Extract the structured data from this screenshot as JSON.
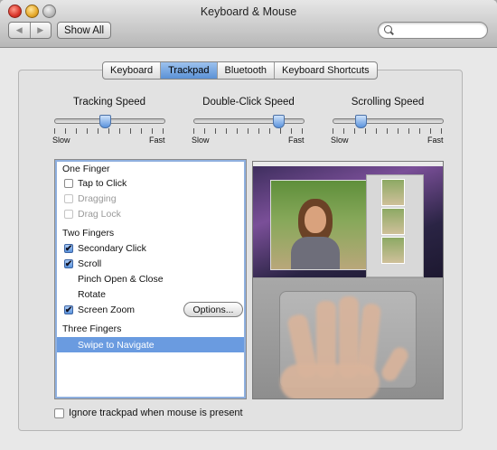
{
  "window": {
    "title": "Keyboard & Mouse",
    "show_all": "Show All",
    "search_placeholder": "",
    "nav_back": "◀",
    "nav_forward": "▶"
  },
  "tabs": [
    {
      "label": "Keyboard",
      "active": false
    },
    {
      "label": "Trackpad",
      "active": true
    },
    {
      "label": "Bluetooth",
      "active": false
    },
    {
      "label": "Keyboard Shortcuts",
      "active": false
    }
  ],
  "sliders": [
    {
      "label": "Tracking Speed",
      "min_label": "Slow",
      "max_label": "Fast",
      "value": 0.45
    },
    {
      "label": "Double-Click Speed",
      "min_label": "Slow",
      "max_label": "Fast",
      "value": 0.75
    },
    {
      "label": "Scrolling Speed",
      "min_label": "Slow",
      "max_label": "Fast",
      "value": 0.25
    }
  ],
  "gestures": {
    "one_finger": {
      "header": "One Finger",
      "items": [
        {
          "label": "Tap to Click",
          "checked": false,
          "disabled": false
        },
        {
          "label": "Dragging",
          "checked": false,
          "disabled": true
        },
        {
          "label": "Drag Lock",
          "checked": false,
          "disabled": true
        }
      ]
    },
    "two_fingers": {
      "header": "Two Fingers",
      "items": [
        {
          "label": "Secondary Click",
          "checked": true
        },
        {
          "label": "Scroll",
          "checked": true
        },
        {
          "label": "Pinch Open & Close"
        },
        {
          "label": "Rotate"
        },
        {
          "label": "Screen Zoom",
          "checked": true
        }
      ]
    },
    "three_fingers": {
      "header": "Three Fingers",
      "items": [
        {
          "label": "Swipe to Navigate",
          "selected": true
        }
      ]
    },
    "options_button": "Options..."
  },
  "footer": {
    "ignore_trackpad": "Ignore trackpad when mouse is present",
    "checked": false
  },
  "icons": {
    "checkmark": "✔"
  }
}
